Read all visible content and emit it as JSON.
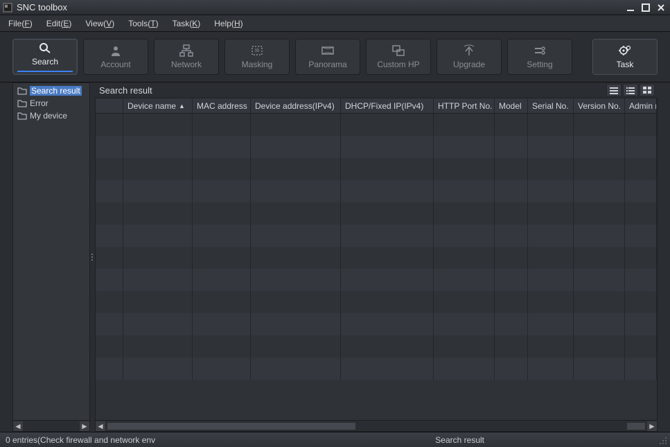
{
  "app": {
    "title": "SNC toolbox"
  },
  "menu": {
    "file": "File(F)",
    "edit": "Edit(E)",
    "view": "View(V)",
    "tools": "Tools(T)",
    "task": "Task(K)",
    "help": "Help(H)"
  },
  "toolbar": {
    "search": "Search",
    "account": "Account",
    "network": "Network",
    "masking": "Masking",
    "panorama": "Panorama",
    "customhp": "Custom HP",
    "upgrade": "Upgrade",
    "setting": "Setting",
    "task": "Task"
  },
  "sidebar": {
    "items": [
      {
        "label": "Search result"
      },
      {
        "label": "Error"
      },
      {
        "label": "My device"
      }
    ]
  },
  "main": {
    "title": "Search result",
    "columns": [
      "",
      "Device name",
      "MAC address",
      "Device address(IPv4)",
      "DHCP/Fixed IP(IPv4)",
      "HTTP Port No.",
      "Model",
      "Serial No.",
      "Version No.",
      "Admin na"
    ]
  },
  "status": {
    "left": "0 entries(Check firewall and network env",
    "right": "Search result"
  }
}
